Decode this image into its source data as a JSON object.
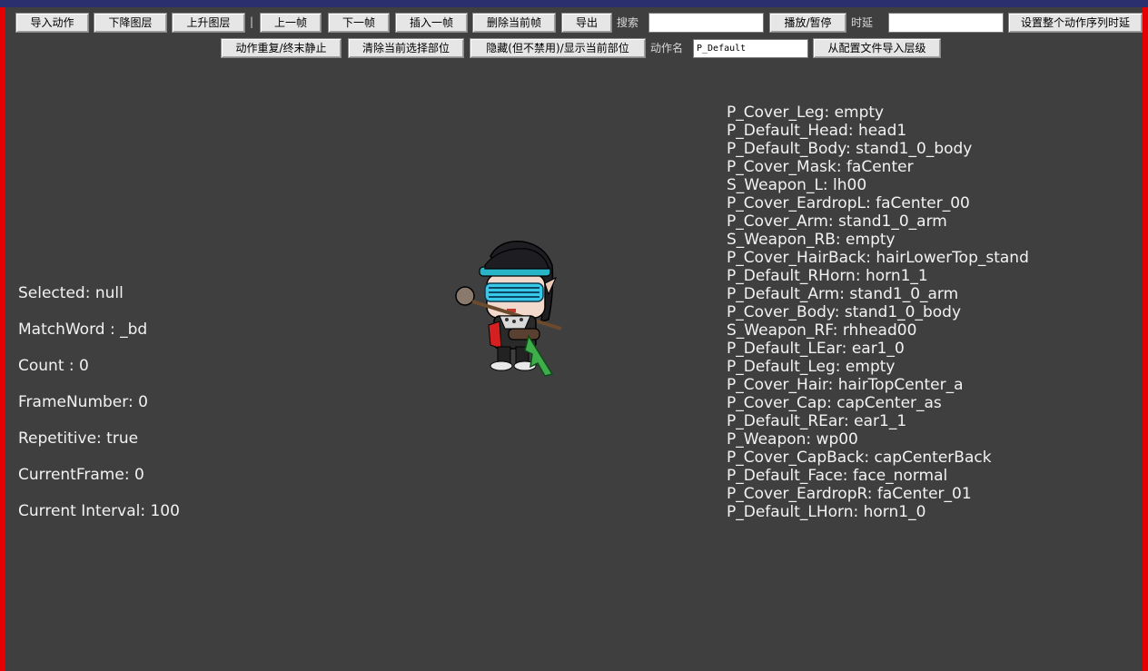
{
  "toolbar1": {
    "import_action": "导入动作",
    "layer_down": "下降图层",
    "layer_up": "上升图层",
    "separator": "|",
    "prev_frame": "上一帧",
    "next_frame": "下一帧",
    "insert_frame": "插入一帧",
    "delete_frame": "删除当前帧",
    "export": "导出",
    "search_label": "搜索",
    "search_value": "",
    "play_pause": "播放/暂停",
    "delay_label": "时延",
    "delay_value": "",
    "set_all_delay": "设置整个动作序列时延"
  },
  "toolbar2": {
    "repeat_toggle": "动作重复/终末静止",
    "clear_selection": "清除当前选择部位",
    "hide_show": "隐藏(但不禁用)/显示当前部位",
    "action_name_label": "动作名",
    "action_name_value": "P_Default",
    "import_layers": "从配置文件导入层级"
  },
  "info": [
    "Selected: null",
    "MatchWord : _bd",
    "Count : 0",
    "FrameNumber: 0",
    "Repetitive: true",
    "CurrentFrame: 0",
    "Current Interval: 100"
  ],
  "parts": [
    "P_Cover_Leg: empty",
    "P_Default_Head: head1",
    "P_Default_Body: stand1_0_body",
    "P_Cover_Mask: faCenter",
    "S_Weapon_L: lh00",
    "P_Cover_EardropL: faCenter_00",
    "P_Cover_Arm: stand1_0_arm",
    "S_Weapon_RB: empty",
    "P_Cover_HairBack: hairLowerTop_stand",
    "P_Default_RHorn: horn1_1",
    "P_Default_Arm: stand1_0_arm",
    "P_Cover_Body: stand1_0_body",
    "S_Weapon_RF: rhhead00",
    "P_Default_LEar: ear1_0",
    "P_Default_Leg: empty",
    "P_Cover_Hair: hairTopCenter_a",
    "P_Cover_Cap: capCenter_as",
    "P_Default_REar: ear1_1",
    "P_Weapon: wp00",
    "P_Cover_CapBack: capCenterBack",
    "P_Default_Face: face_normal",
    "P_Cover_EardropR: faCenter_01",
    "P_Default_LHorn: horn1_0"
  ],
  "colors": {
    "background": "#3f3f3f",
    "border": "#e40000",
    "titlebar": "#2b2f6e"
  }
}
